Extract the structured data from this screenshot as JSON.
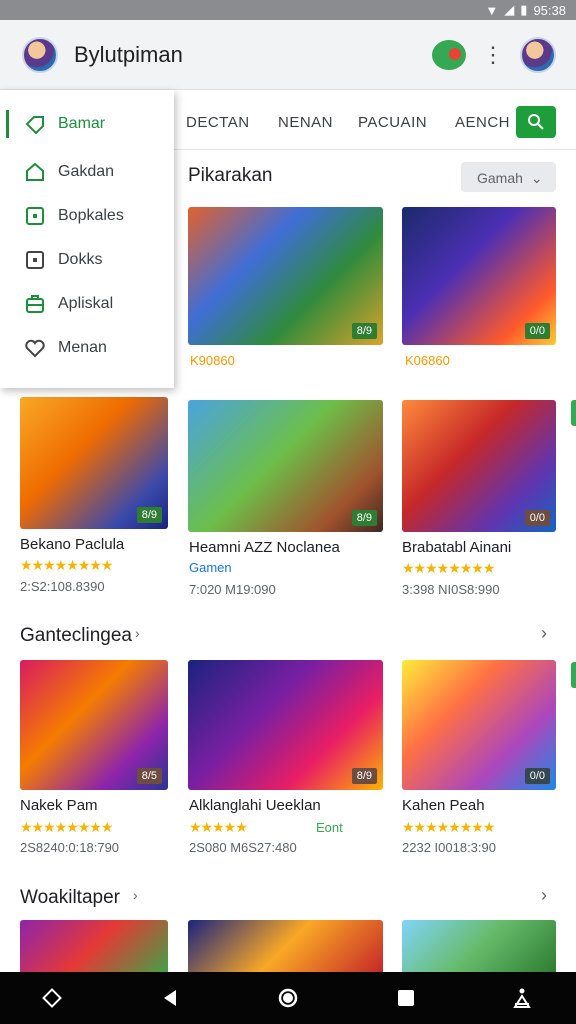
{
  "status_bar": {
    "time": "95:38"
  },
  "app_bar": {
    "title": "Bylutpiman"
  },
  "tabs": [
    {
      "label": "DECTAN"
    },
    {
      "label": "NENAN"
    },
    {
      "label": "PACUAIN"
    },
    {
      "label": "AENCH"
    }
  ],
  "drawer": {
    "items": [
      {
        "label": "Bamar",
        "icon": "tag-icon",
        "active": true
      },
      {
        "label": "Gakdan",
        "icon": "home-icon"
      },
      {
        "label": "Bopkales",
        "icon": "box-icon"
      },
      {
        "label": "Dokks",
        "icon": "square-icon"
      },
      {
        "label": "Apliskal",
        "icon": "briefcase-icon"
      },
      {
        "label": "Menan",
        "icon": "heart-icon"
      }
    ]
  },
  "section1": {
    "title": "Pikarakan",
    "filter": "Gamah",
    "cards": [
      {
        "badge": "8/9",
        "price": "K90860"
      },
      {
        "badge": "0/0",
        "price": "K06860"
      }
    ]
  },
  "row2": {
    "cards": [
      {
        "badge": "8/9",
        "name": "Bekano Paclula",
        "stars": "★★★★★★★★",
        "meta": "2:S2:108.8390"
      },
      {
        "badge": "8/9",
        "name": "Heamni AZZ Noclanea",
        "sub": "Gamen",
        "meta": "7:020 M19:090"
      },
      {
        "badge": "0/0",
        "name": "Brabatabl Ainani",
        "stars": "★★★★★★★★",
        "meta": "3:398 NI0S8:990"
      }
    ]
  },
  "section2": {
    "title": "Ganteclingea",
    "cards": [
      {
        "badge": "8/5",
        "name": "Nakek Pam",
        "stars": "★★★★★★★★",
        "meta": "2S8240:0:18:790"
      },
      {
        "badge": "8/9",
        "name": "Alklanglahi Ueeklan",
        "stars": "★★★★★",
        "sub": "Eont",
        "meta": "2S080 M6S27:480"
      },
      {
        "badge": "0/0",
        "name": "Kahen Peah",
        "stars": "★★★★★★★★",
        "meta": "2232 I0018:3:90"
      }
    ]
  },
  "section3": {
    "title": "Woakiltaper"
  },
  "colors": {
    "accent": "#1e8e3e",
    "star": "#f4b400",
    "link": "#1a73e8"
  }
}
